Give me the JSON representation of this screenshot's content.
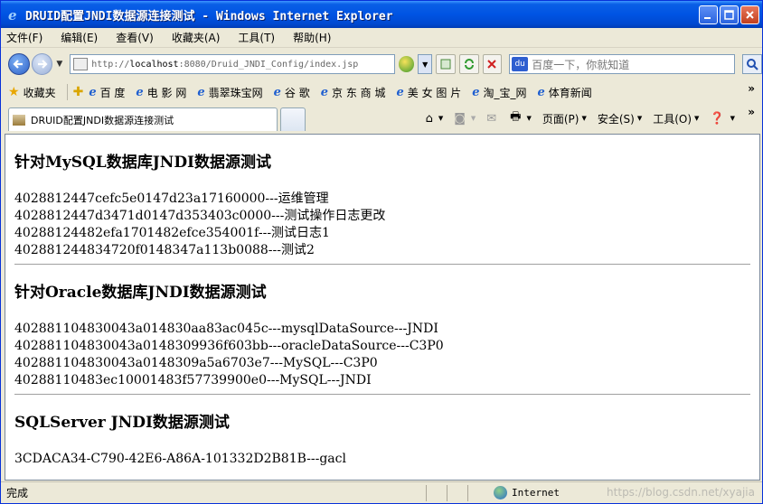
{
  "window": {
    "title": "DRUID配置JNDI数据源连接测试 - Windows Internet Explorer"
  },
  "menu": [
    "文件(F)",
    "编辑(E)",
    "查看(V)",
    "收藏夹(A)",
    "工具(T)",
    "帮助(H)"
  ],
  "address": {
    "url_prefix": "http://",
    "url_host": "localhost",
    "url_rest": ":8080/Druid_JNDI_Config/index.jsp"
  },
  "search": {
    "placeholder": "百度一下，你就知道"
  },
  "favorites": {
    "label": "收藏夹",
    "links": [
      "百 度",
      "电 影 网",
      "翡翠珠宝网",
      "谷 歌",
      "京 东 商 城",
      "美 女 图 片",
      "淘_宝_网",
      "体育新闻"
    ]
  },
  "tab": {
    "title": "DRUID配置JNDI数据源连接测试"
  },
  "commands": {
    "page": "页面(P)",
    "safety": "安全(S)",
    "tools": "工具(O)"
  },
  "content": {
    "sections": [
      {
        "heading": "针对MySQL数据库JNDI数据源测试",
        "rows": [
          "4028812447cefc5e0147d23a17160000---运维管理",
          "4028812447d3471d0147d353403c0000---测试操作日志更改",
          "40288124482efa1701482efce354001f---测试日志1",
          "402881244834720f0148347a113b0088---测试2"
        ]
      },
      {
        "heading": "针对Oracle数据库JNDI数据源测试",
        "rows": [
          "402881104830043a014830aa83ac045c---mysqlDataSource---JNDI",
          "402881104830043a0148309936f603bb---oracleDataSource---C3P0",
          "402881104830043a0148309a5a6703e7---MySQL---C3P0",
          "40288110483ec10001483f57739900e0---MySQL---JNDI"
        ]
      },
      {
        "heading": "SQLServer JNDI数据源测试",
        "rows": [
          "3CDACA34-C790-42E6-A86A-101332D2B81B---gacl"
        ]
      }
    ]
  },
  "status": {
    "text": "完成",
    "zone": "Internet",
    "watermark": "https://blog.csdn.net/xyajia"
  }
}
